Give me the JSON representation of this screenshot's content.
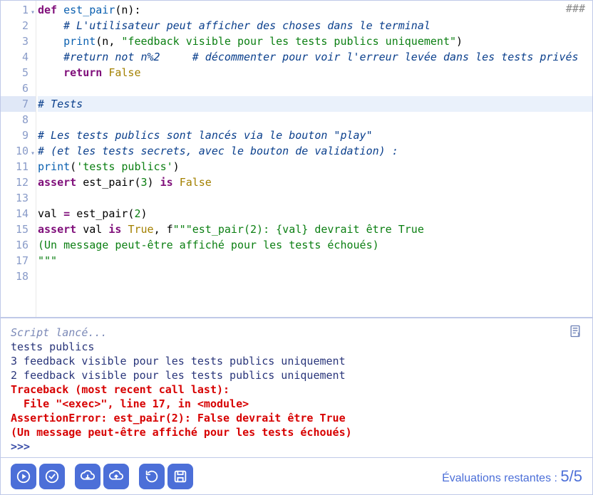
{
  "editor": {
    "right_marker": "###",
    "highlight_line": 7,
    "fold_lines": [
      1,
      10
    ],
    "lines": [
      {
        "n": 1,
        "tokens": [
          {
            "t": "def ",
            "c": "kw"
          },
          {
            "t": "est_pair",
            "c": "fn"
          },
          {
            "t": "(n):",
            "c": ""
          }
        ]
      },
      {
        "n": 2,
        "tokens": [
          {
            "t": "    ",
            "c": ""
          },
          {
            "t": "# L'utilisateur peut afficher des choses dans le terminal",
            "c": "com"
          }
        ]
      },
      {
        "n": 3,
        "tokens": [
          {
            "t": "    ",
            "c": ""
          },
          {
            "t": "print",
            "c": "fn"
          },
          {
            "t": "(n, ",
            "c": ""
          },
          {
            "t": "\"feedback visible pour les tests publics uniquement\"",
            "c": "str"
          },
          {
            "t": ")",
            "c": ""
          }
        ]
      },
      {
        "n": 4,
        "tokens": [
          {
            "t": "    ",
            "c": ""
          },
          {
            "t": "#return not n%2     # décommenter pour voir l'erreur levée dans les tests privés",
            "c": "com"
          }
        ]
      },
      {
        "n": 5,
        "tokens": [
          {
            "t": "    ",
            "c": ""
          },
          {
            "t": "return ",
            "c": "kw"
          },
          {
            "t": "False",
            "c": "bool"
          }
        ]
      },
      {
        "n": 6,
        "tokens": []
      },
      {
        "n": 7,
        "tokens": [
          {
            "t": "# Tests",
            "c": "com"
          }
        ]
      },
      {
        "n": 8,
        "tokens": []
      },
      {
        "n": 9,
        "tokens": [
          {
            "t": "# Les tests publics sont lancés via le bouton \"play\"",
            "c": "com"
          }
        ]
      },
      {
        "n": 10,
        "tokens": [
          {
            "t": "# (et les tests secrets, avec le bouton de validation) :",
            "c": "com"
          }
        ]
      },
      {
        "n": 11,
        "tokens": [
          {
            "t": "print",
            "c": "fn"
          },
          {
            "t": "(",
            "c": ""
          },
          {
            "t": "'tests publics'",
            "c": "str"
          },
          {
            "t": ")",
            "c": ""
          }
        ]
      },
      {
        "n": 12,
        "tokens": [
          {
            "t": "assert",
            "c": "kw"
          },
          {
            "t": " est_pair(",
            "c": ""
          },
          {
            "t": "3",
            "c": "num"
          },
          {
            "t": ") ",
            "c": ""
          },
          {
            "t": "is ",
            "c": "kw"
          },
          {
            "t": "False",
            "c": "bool"
          }
        ]
      },
      {
        "n": 13,
        "tokens": []
      },
      {
        "n": 14,
        "tokens": [
          {
            "t": "val ",
            "c": ""
          },
          {
            "t": "= ",
            "c": "op"
          },
          {
            "t": "est_pair(",
            "c": ""
          },
          {
            "t": "2",
            "c": "num"
          },
          {
            "t": ")",
            "c": ""
          }
        ]
      },
      {
        "n": 15,
        "tokens": [
          {
            "t": "assert",
            "c": "kw"
          },
          {
            "t": " val ",
            "c": ""
          },
          {
            "t": "is ",
            "c": "kw"
          },
          {
            "t": "True",
            "c": "bool"
          },
          {
            "t": ", f",
            "c": ""
          },
          {
            "t": "\"\"\"est_pair(2): {val} devrait être True",
            "c": "str"
          }
        ]
      },
      {
        "n": 16,
        "tokens": [
          {
            "t": "(Un message peut-être affiché pour les tests échoués)",
            "c": "str"
          }
        ]
      },
      {
        "n": 17,
        "tokens": [
          {
            "t": "\"\"\"",
            "c": "str"
          }
        ]
      },
      {
        "n": 18,
        "tokens": []
      }
    ]
  },
  "console": {
    "status": "Script lancé...",
    "lines": [
      {
        "t": "tests publics",
        "c": ""
      },
      {
        "t": "3 feedback visible pour les tests publics uniquement",
        "c": ""
      },
      {
        "t": "2 feedback visible pour les tests publics uniquement",
        "c": ""
      },
      {
        "t": "Traceback (most recent call last):",
        "c": "error"
      },
      {
        "t": "  File \"<exec>\", line 17, in <module>",
        "c": "error"
      },
      {
        "t": "AssertionError: est_pair(2): False devrait être True",
        "c": "error"
      },
      {
        "t": "(Un message peut-être affiché pour les tests échoués)",
        "c": "error"
      }
    ],
    "prompt": ">>>"
  },
  "footer": {
    "eval_label": "Évaluations restantes : ",
    "eval_value": "5/5"
  }
}
